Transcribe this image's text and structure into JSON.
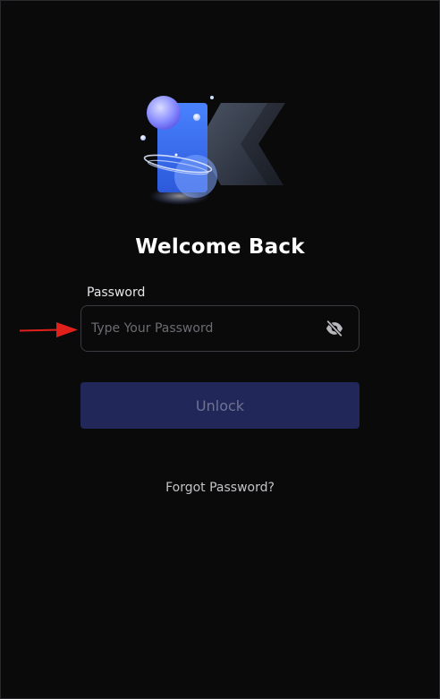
{
  "logo": {
    "icon": "app-logo-icon"
  },
  "heading": {
    "title": "Welcome Back"
  },
  "password": {
    "label": "Password",
    "placeholder": "Type Your Password",
    "value": "",
    "toggle_icon": "eye-off-icon"
  },
  "actions": {
    "unlock_label": "Unlock",
    "forgot_label": "Forgot Password?"
  },
  "annotation": {
    "icon": "red-arrow-icon",
    "color": "#e0201a"
  },
  "colors": {
    "background": "#0a0a0b",
    "button_bg": "#22275a",
    "button_text": "#6e7293",
    "field_border": "#3a3a40",
    "accent_blue": "#3a6df0"
  }
}
